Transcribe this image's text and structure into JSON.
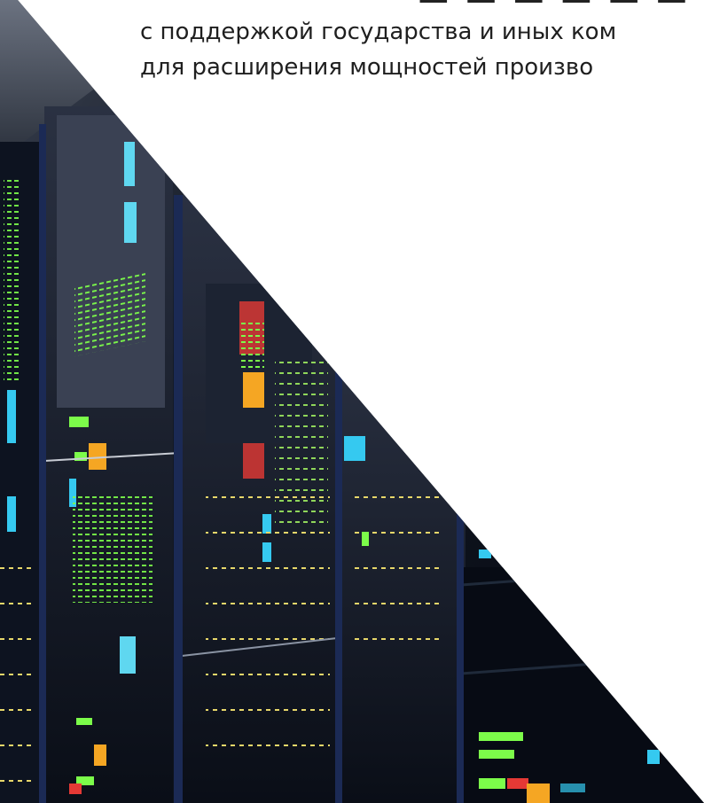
{
  "header": {
    "subtitle_line_1": "с поддержкой государства и иных ком",
    "subtitle_line_2": "для расширения мощностей произво"
  },
  "hero_image": {
    "subject": "server-racks-photo",
    "accent_colors": {
      "rack_dark": "#0b1220",
      "rack_panel": "#1a2233",
      "led_green": "#7CFC4A",
      "led_cyan": "#35C9F0",
      "led_orange": "#F5A623",
      "led_red": "#E53935"
    }
  }
}
